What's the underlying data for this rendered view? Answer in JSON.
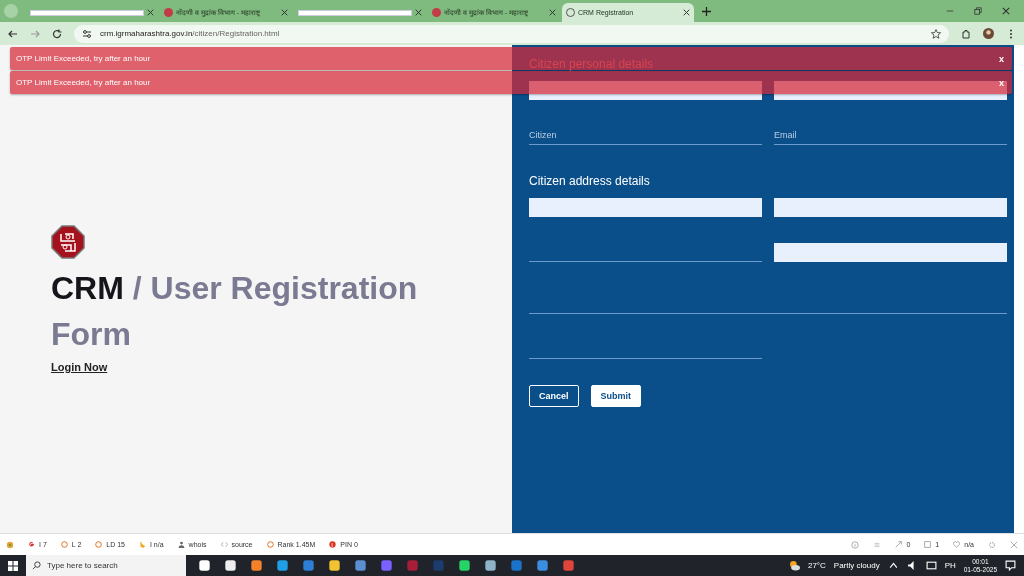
{
  "browser": {
    "tabs": [
      {
        "kind": "redacted",
        "selected": false
      },
      {
        "kind": "normal",
        "title": "नोंदणी व मुद्रांक विभाग - महाराष्ट्र",
        "selected": false
      },
      {
        "kind": "redacted",
        "selected": false
      },
      {
        "kind": "normal",
        "title": "नोंदणी व मुद्रांक विभाग - महाराष्ट्र",
        "selected": false
      },
      {
        "kind": "normal",
        "title": "CRM Registration",
        "selected": true
      }
    ],
    "url": {
      "host": "crm.igrmaharashtra.gov.in",
      "path": "/citizen/Registration.html"
    }
  },
  "toasts": [
    {
      "message": "OTP Limit Exceeded, try after an hour",
      "close": "x"
    },
    {
      "message": "OTP Limit Exceeded, try after an hour",
      "close": "x"
    }
  ],
  "left": {
    "brand": "CRM",
    "title": "/ User Registration Form",
    "link": "Login Now"
  },
  "form": {
    "sections": [
      {
        "heading": "Citizen personal details",
        "rows": [
          [
            {
              "kind": "filled"
            },
            {
              "kind": "filled"
            }
          ],
          [
            {
              "kind": "line",
              "placeholder": "Citizen"
            },
            {
              "kind": "line",
              "placeholder": "Email"
            }
          ]
        ]
      },
      {
        "heading": "Citizen address details",
        "rows": [
          [
            {
              "kind": "filled"
            },
            {
              "kind": "filled"
            }
          ],
          [
            {
              "kind": "line"
            },
            {
              "kind": "filled"
            }
          ],
          [
            {
              "kind": "wide"
            }
          ],
          [
            {
              "kind": "line"
            }
          ]
        ]
      }
    ],
    "buttons": [
      {
        "label": "Cancel",
        "kind": "outline"
      },
      {
        "label": "Submit",
        "kind": "solid"
      }
    ]
  },
  "extension_bar": {
    "items": [
      {
        "kind": "google",
        "text": "I 7"
      },
      {
        "kind": "circle",
        "text": "L 2"
      },
      {
        "kind": "circle",
        "text": "LD 15"
      },
      {
        "kind": "bing",
        "text": "I n/a"
      },
      {
        "kind": "person",
        "text": "whois"
      },
      {
        "kind": "code",
        "text": "source"
      },
      {
        "kind": "circle",
        "text": "Rank 1.45M"
      },
      {
        "kind": "pin",
        "text": "PIN 0"
      }
    ],
    "right_items": [
      {
        "kind": "link",
        "text": "0"
      },
      {
        "kind": "page",
        "text": "1"
      },
      {
        "kind": "heart",
        "text": "n/a"
      }
    ]
  },
  "taskbar": {
    "search": "Type here to search",
    "temperature": "27°C",
    "weather": "Partly cloudy",
    "language": "PH",
    "time": "00:01",
    "date": "01-05-2025"
  }
}
